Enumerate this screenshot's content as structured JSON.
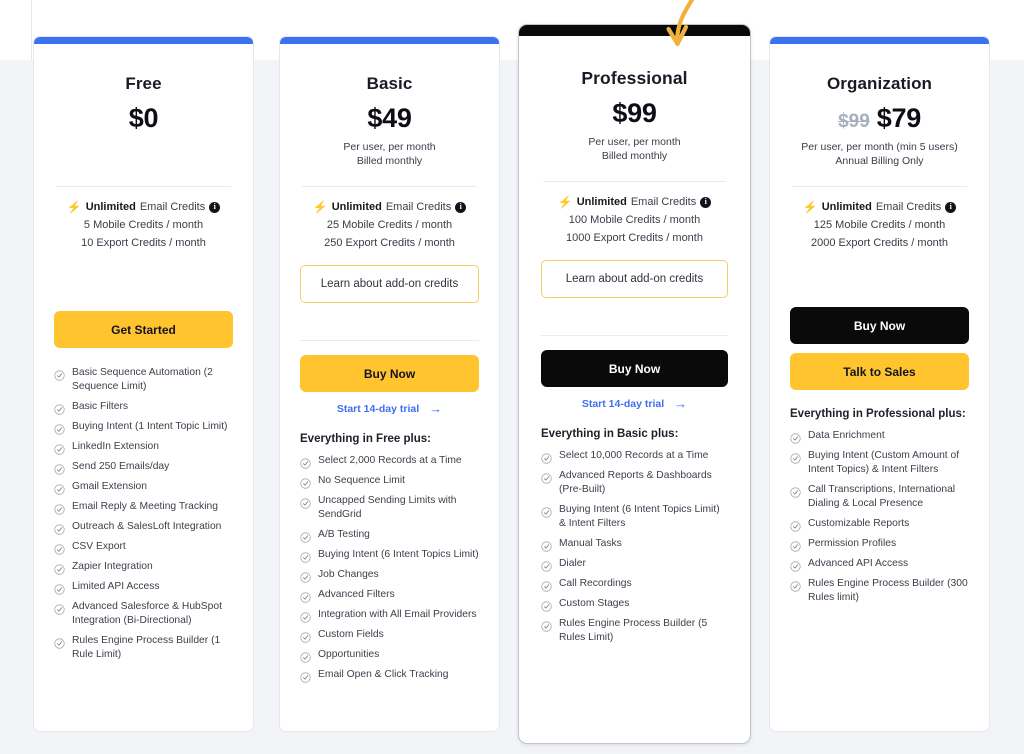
{
  "colors": {
    "accent_blue": "#3B72F0",
    "accent_yellow": "#FFC42E",
    "dark": "#0A0A0A",
    "page_bg": "#F2F4F8",
    "addon_border": "#F6CD6B",
    "bolt": "#F7A823",
    "link_blue": "#3F6EF0"
  },
  "icons": {
    "bolt": "⚡",
    "info": "i",
    "arrow_right": "→",
    "check": "check-circle"
  },
  "annotation": {
    "name": "highlight-arrow",
    "points_to": "Professional"
  },
  "plans": [
    {
      "id": "free",
      "name": "Free",
      "price": "$0",
      "price_old": "",
      "billing": "",
      "top_bar": "blue",
      "featured": false,
      "credits": {
        "unlimited_strong": "Unlimited",
        "unlimited_rest": "Email Credits",
        "lines": [
          "5 Mobile Credits / month",
          "10 Export Credits / month"
        ]
      },
      "addon_button": "",
      "buttons": [
        {
          "label": "Get Started",
          "style": "yellow"
        }
      ],
      "trial_link": "",
      "features_title": "",
      "features": [
        "Basic Sequence Automation (2 Sequence Limit)",
        "Basic Filters",
        "Buying Intent (1 Intent Topic Limit)",
        "LinkedIn Extension",
        "Send 250 Emails/day",
        "Gmail Extension",
        "Email Reply & Meeting Tracking",
        "Outreach & SalesLoft Integration",
        "CSV Export",
        "Zapier Integration",
        "Limited API Access",
        "Advanced Salesforce & HubSpot Integration (Bi-Directional)",
        "Rules Engine Process Builder (1 Rule Limit)"
      ]
    },
    {
      "id": "basic",
      "name": "Basic",
      "price": "$49",
      "price_old": "",
      "billing": "Per user, per month\nBilled monthly",
      "top_bar": "blue",
      "featured": false,
      "credits": {
        "unlimited_strong": "Unlimited",
        "unlimited_rest": "Email Credits",
        "lines": [
          "25 Mobile Credits / month",
          "250 Export Credits / month"
        ]
      },
      "addon_button": "Learn about add-on credits",
      "buttons": [
        {
          "label": "Buy Now",
          "style": "yellow"
        }
      ],
      "trial_link": "Start 14-day trial",
      "features_title": "Everything in Free plus:",
      "features": [
        "Select 2,000 Records at a Time",
        "No Sequence Limit",
        "Uncapped Sending Limits with SendGrid",
        "A/B Testing",
        "Buying Intent (6 Intent Topics Limit)",
        "Job Changes",
        "Advanced Filters",
        "Integration with All Email Providers",
        "Custom Fields",
        "Opportunities",
        "Email Open & Click Tracking"
      ]
    },
    {
      "id": "professional",
      "name": "Professional",
      "price": "$99",
      "price_old": "",
      "billing": "Per user, per month\nBilled monthly",
      "top_bar": "dark",
      "featured": true,
      "credits": {
        "unlimited_strong": "Unlimited",
        "unlimited_rest": "Email Credits",
        "lines": [
          "100 Mobile Credits / month",
          "1000 Export Credits / month"
        ]
      },
      "addon_button": "Learn about add-on credits",
      "buttons": [
        {
          "label": "Buy Now",
          "style": "black"
        }
      ],
      "trial_link": "Start 14-day trial",
      "features_title": "Everything in Basic plus:",
      "features": [
        "Select 10,000 Records at a Time",
        "Advanced Reports & Dashboards (Pre-Built)",
        "Buying Intent (6 Intent Topics Limit) & Intent Filters",
        "Manual Tasks",
        "Dialer",
        "Call Recordings",
        "Custom Stages",
        "Rules Engine Process Builder (5 Rules Limit)"
      ]
    },
    {
      "id": "organization",
      "name": "Organization",
      "price": "$79",
      "price_old": "$99",
      "billing": "Per user, per month (min 5 users)\nAnnual Billing Only",
      "top_bar": "blue",
      "featured": false,
      "credits": {
        "unlimited_strong": "Unlimited",
        "unlimited_rest": "Email Credits",
        "lines": [
          "125 Mobile Credits / month",
          "2000 Export Credits / month"
        ]
      },
      "addon_button": "",
      "buttons": [
        {
          "label": "Buy Now",
          "style": "black"
        },
        {
          "label": "Talk to Sales",
          "style": "yellow"
        }
      ],
      "trial_link": "",
      "features_title": "Everything in Professional plus:",
      "features": [
        "Data Enrichment",
        "Buying Intent (Custom Amount of Intent Topics) & Intent Filters",
        "Call Transcriptions, International Dialing & Local Presence",
        "Customizable Reports",
        "Permission Profiles",
        "Advanced API Access",
        "Rules Engine Process Builder (300 Rules limit)"
      ]
    }
  ]
}
